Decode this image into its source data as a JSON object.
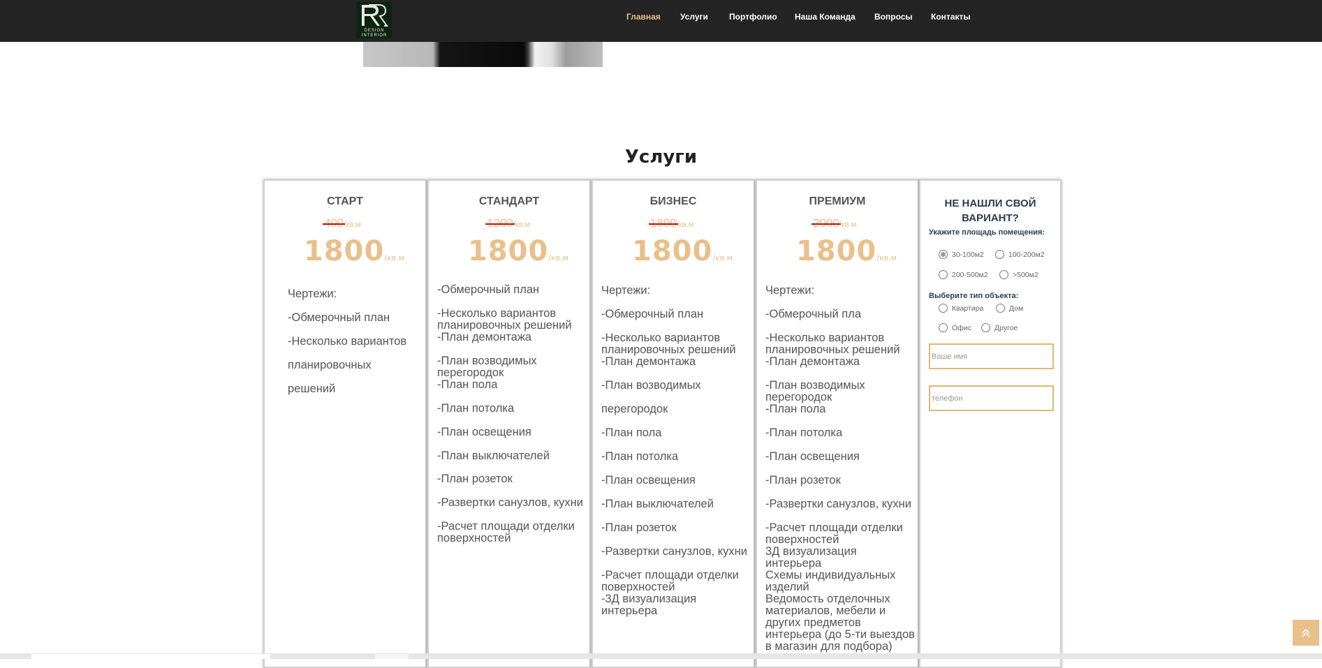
{
  "nav": {
    "logo_text": "Design Interior",
    "items": [
      {
        "label": "Главная",
        "active": true
      },
      {
        "label": "Услуги"
      },
      {
        "label": "Портфолио"
      },
      {
        "label": "Наша Команда"
      },
      {
        "label": "Вопросы"
      },
      {
        "label": "Контакты"
      }
    ]
  },
  "services": {
    "title": "Услуги",
    "unit": "/кв.м",
    "plans": [
      {
        "name": "СТАРТ",
        "old_price": "400",
        "price": "1800",
        "features": [
          "Чертежи:",
          "-Обмерочный план",
          "-Несколько вариантов",
          "планировочных",
          "решений"
        ]
      },
      {
        "name": "СТАНДАРТ",
        "old_price": "1200",
        "price": "1800",
        "features": [
          "-Обмерочный план",
          "-Несколько вариантов планировочных решений",
          "-План демонтажа",
          "-План возводимых перегородок",
          "-План пола",
          "-План потолка",
          "-План освещения",
          "-План выключателей",
          "-План розеток",
          "-Развертки санузлов, кухни",
          "-Расчет площади отделки поверхностей"
        ]
      },
      {
        "name": "БИЗНЕС",
        "old_price": "1800",
        "price": "1800",
        "features": [
          "Чертежи:",
          "-Обмерочный план",
          "-Несколько вариантов планировочных решений",
          "-План демонтажа",
          "-План возводимых",
          "перегородок",
          "-План пола",
          "-План потолка",
          "-План освещения",
          "-План выключателей",
          "-План розеток",
          "-Развертки санузлов, кухни",
          "-Расчет площади отделки поверхностей",
          "-3Д визуализация интерьера"
        ]
      },
      {
        "name": "ПРЕМИУМ",
        "old_price": "2000",
        "price": "1800",
        "features": [
          "Чертежи:",
          "-Обмерочный пла",
          "-Несколько вариантов планировочных решений",
          "-План демонтажа",
          "-План возводимых перегородок",
          "-План пола",
          "-План потолка",
          "-План освещения",
          "-План розеток",
          "-Развертки санузлов, кухни",
          "-Расчет площади отделки поверхностей",
          "3Д визуализация интерьера",
          "Схемы индивидуальных изделий",
          "Ведомость отделочных материалов, мебели и других предметов интерьера (до 5-ти выездов в магазин для подбора)"
        ]
      }
    ]
  },
  "form": {
    "title": "НЕ НАШЛИ СВОЙ ВАРИАНТ?",
    "area_label": "Укажите площадь помещения:",
    "area_options": [
      "30-100м2",
      "100-200м2",
      "200-500м2",
      ">500м2"
    ],
    "area_selected": "30-100м2",
    "type_label": "Выберите тип объекта:",
    "type_options": [
      "Квартира",
      "Дом",
      "Офис",
      "Другое"
    ],
    "name_placeholder": "Ваше имя",
    "phone_placeholder": "телефон"
  },
  "colors": {
    "navbar": "#242424",
    "accent_gold": "#e9c08a",
    "strike_red": "#b3140e",
    "form_title": "#2c3e50"
  },
  "icons": {
    "scroll_to_top": "double-chevron-up-icon"
  }
}
